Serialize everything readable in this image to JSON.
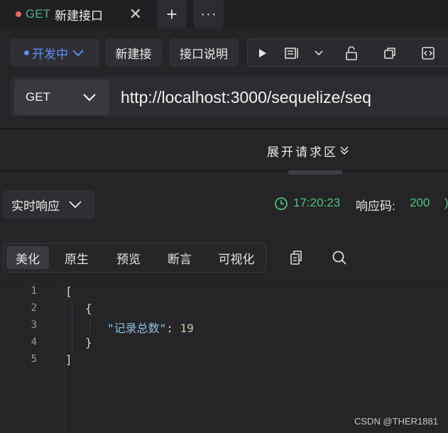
{
  "tab": {
    "method": "GET",
    "title": "新建接口",
    "close": "✕",
    "add": "+",
    "more": "···"
  },
  "toolbar": {
    "env_label": "开发中",
    "new_conn": "新建接",
    "api_doc": "接口说明",
    "tools": [
      "play-icon",
      "doc-icon",
      "chevron-down-icon",
      "unlock-icon",
      "copy-icon",
      "code-icon"
    ]
  },
  "request": {
    "method": "GET",
    "url": "http://localhost:3000/sequelize/seq"
  },
  "expand_label": "展开请求区",
  "response": {
    "mode": "实时响应",
    "time": "17:20:23",
    "code_label": "响应码:",
    "code": "200",
    "edge_char": ")"
  },
  "view_tabs": [
    "美化",
    "原生",
    "预览",
    "断言",
    "可视化"
  ],
  "editor": {
    "line_numbers": [
      "1",
      "2",
      "3",
      "4",
      "5"
    ],
    "lines": [
      "[",
      "{",
      "\"记录总数\": 19",
      "}",
      "]"
    ],
    "key": "\"记录总数\"",
    "colon": ": ",
    "value": "19"
  },
  "watermark": "CSDN @THER1881",
  "colors": {
    "accent_blue": "#5c8dfa",
    "success_green": "#4fbf7d",
    "method_green": "#4fb08a",
    "tab_dot": "#e8685c"
  }
}
